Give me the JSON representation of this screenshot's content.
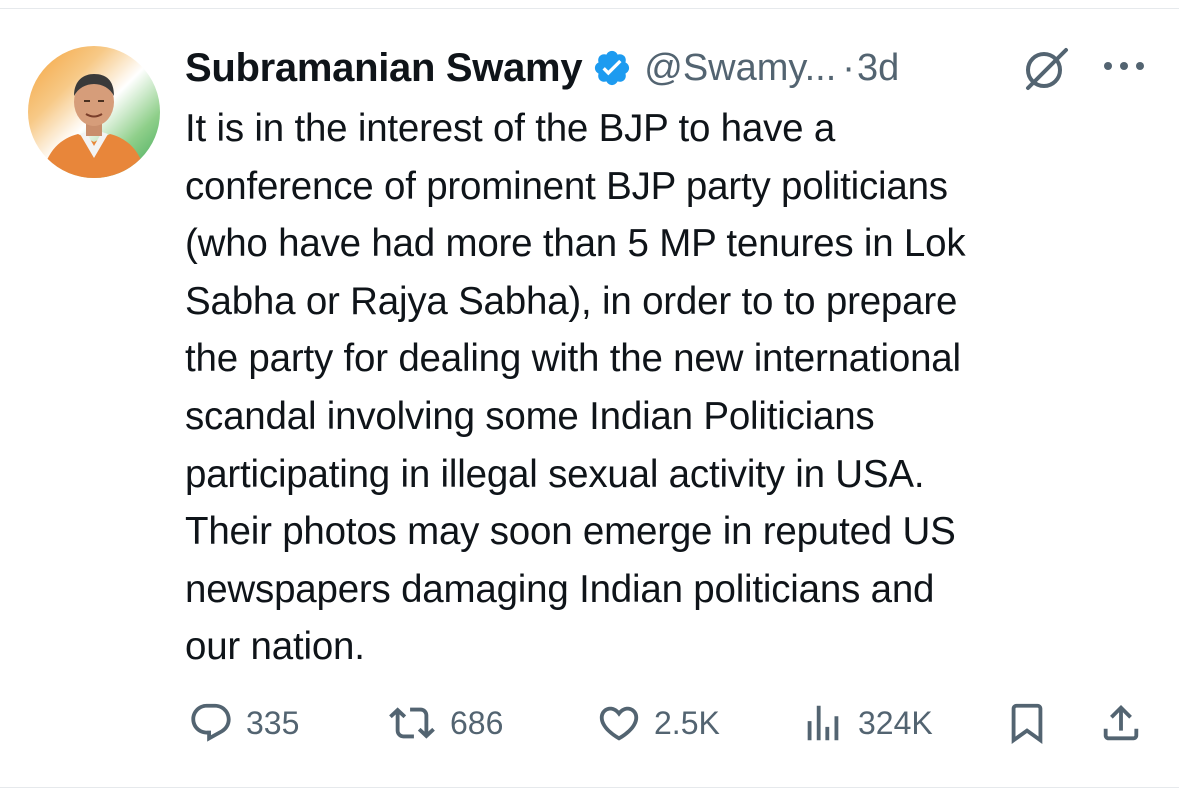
{
  "tweet": {
    "author": {
      "display_name": "Subramanian Swamy",
      "handle": "@Swamy...",
      "verified": true,
      "avatar_icon": "profile-photo"
    },
    "separator": "·",
    "timestamp": "3d",
    "text": "It is in the interest of the BJP to have a\nconference of prominent BJP party politicians\n(who have had more than 5 MP tenures in Lok\nSabha or Rajya Sabha), in order to  to prepare\nthe party for dealing with the new international\nscandal involving some Indian Politicians\nparticipating in illegal sexual activity in USA.\nTheir photos may soon emerge in reputed US\nnewspapers damaging Indian politicians and\nour nation.",
    "actions": {
      "replies": {
        "icon": "reply-icon",
        "count": "335"
      },
      "reposts": {
        "icon": "repost-icon",
        "count": "686"
      },
      "likes": {
        "icon": "heart-icon",
        "count": "2.5K"
      },
      "views": {
        "icon": "views-icon",
        "count": "324K"
      },
      "bookmark": {
        "icon": "bookmark-icon"
      },
      "share": {
        "icon": "share-icon"
      }
    },
    "header_icons": [
      "grok-icon",
      "more-icon"
    ]
  },
  "colors": {
    "text": "#0f1419",
    "secondary": "#536471",
    "verified_blue": "#1d9bf0",
    "divider": "#e6e9ec"
  }
}
